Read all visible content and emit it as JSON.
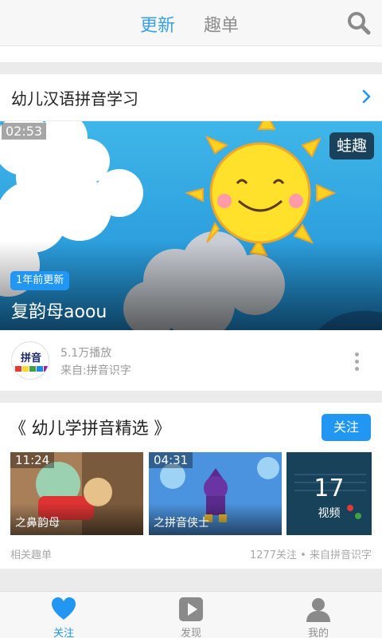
{
  "header": {
    "tabs": [
      {
        "label": "更新",
        "active": true
      },
      {
        "label": "趣单",
        "active": false
      }
    ],
    "icon": "search-icon"
  },
  "series": {
    "title": "幼儿汉语拼音学习",
    "icon": "chevron-right-icon"
  },
  "video": {
    "duration": "02:53",
    "brand": "蛙趣",
    "update_badge": "1年前更新",
    "title": "复韵母aoou",
    "plays": "5.1万播放",
    "source": "来自:拼音识字",
    "avatar_text": "拼音",
    "more_icon": "more-vertical-icon"
  },
  "playlist": {
    "title": "《 幼儿学拼音精选 》",
    "follow_label": "关注",
    "thumbs": [
      {
        "duration": "11:24",
        "caption": "之鼻韵母"
      },
      {
        "duration": "04:31",
        "caption": "之拼音侠士"
      }
    ],
    "count": {
      "number": "17",
      "label": "视频"
    },
    "related_label": "相关趣单",
    "stats": "1277关注 • 来自拼音识字"
  },
  "nav": [
    {
      "label": "关注",
      "icon": "heart-icon",
      "active": true
    },
    {
      "label": "发现",
      "icon": "play-icon",
      "active": false
    },
    {
      "label": "我的",
      "icon": "user-icon",
      "active": false
    }
  ],
  "colors": {
    "accent": "#2196f3",
    "tab_active": "#3aa0e6",
    "muted": "#9a9a9a"
  }
}
